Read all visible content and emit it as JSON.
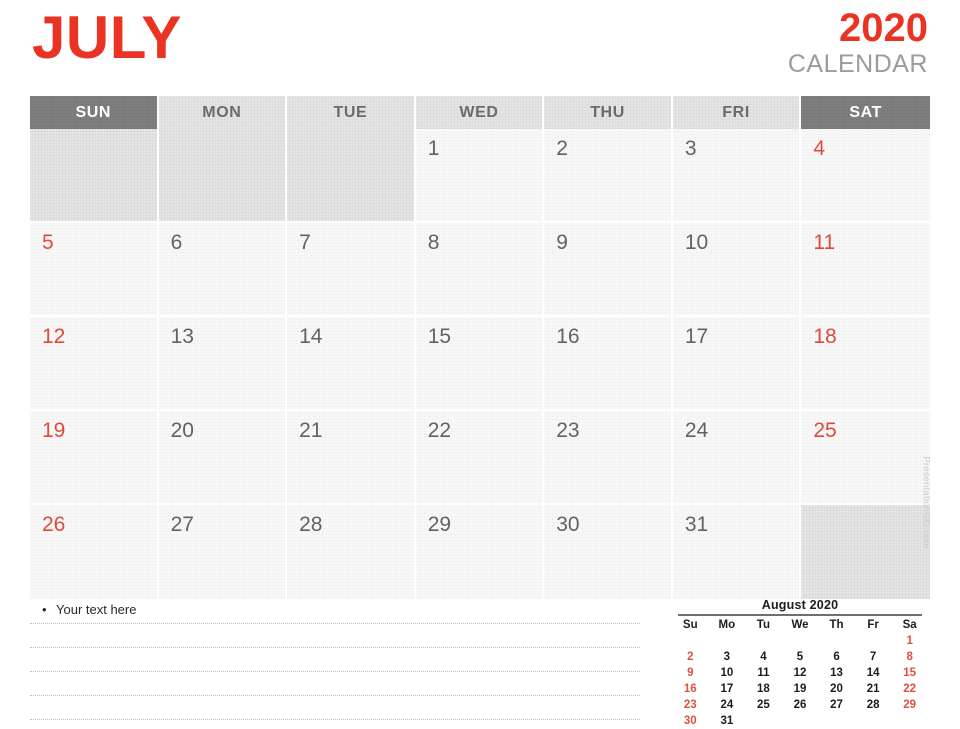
{
  "header": {
    "month": "JULY",
    "year": "2020",
    "calendar_word": "CALENDAR",
    "month_color": "#ea3323",
    "year_color": "#ea3323",
    "calendar_word_color": "#9b9b9b"
  },
  "weekdays": [
    {
      "label": "SUN",
      "weekend": true
    },
    {
      "label": "MON",
      "weekend": false
    },
    {
      "label": "TUE",
      "weekend": false
    },
    {
      "label": "WED",
      "weekend": false
    },
    {
      "label": "THU",
      "weekend": false
    },
    {
      "label": "FRI",
      "weekend": false
    },
    {
      "label": "SAT",
      "weekend": true
    }
  ],
  "weeks": [
    [
      {
        "day": "",
        "blank": true,
        "weekend": true
      },
      {
        "day": "",
        "blank": true,
        "weekend": false
      },
      {
        "day": "",
        "blank": true,
        "weekend": false
      },
      {
        "day": "1",
        "blank": false,
        "weekend": false
      },
      {
        "day": "2",
        "blank": false,
        "weekend": false
      },
      {
        "day": "3",
        "blank": false,
        "weekend": false
      },
      {
        "day": "4",
        "blank": false,
        "weekend": true
      }
    ],
    [
      {
        "day": "5",
        "blank": false,
        "weekend": true
      },
      {
        "day": "6",
        "blank": false,
        "weekend": false
      },
      {
        "day": "7",
        "blank": false,
        "weekend": false
      },
      {
        "day": "8",
        "blank": false,
        "weekend": false
      },
      {
        "day": "9",
        "blank": false,
        "weekend": false
      },
      {
        "day": "10",
        "blank": false,
        "weekend": false
      },
      {
        "day": "11",
        "blank": false,
        "weekend": true
      }
    ],
    [
      {
        "day": "12",
        "blank": false,
        "weekend": true
      },
      {
        "day": "13",
        "blank": false,
        "weekend": false
      },
      {
        "day": "14",
        "blank": false,
        "weekend": false
      },
      {
        "day": "15",
        "blank": false,
        "weekend": false
      },
      {
        "day": "16",
        "blank": false,
        "weekend": false
      },
      {
        "day": "17",
        "blank": false,
        "weekend": false
      },
      {
        "day": "18",
        "blank": false,
        "weekend": true
      }
    ],
    [
      {
        "day": "19",
        "blank": false,
        "weekend": true
      },
      {
        "day": "20",
        "blank": false,
        "weekend": false
      },
      {
        "day": "21",
        "blank": false,
        "weekend": false
      },
      {
        "day": "22",
        "blank": false,
        "weekend": false
      },
      {
        "day": "23",
        "blank": false,
        "weekend": false
      },
      {
        "day": "24",
        "blank": false,
        "weekend": false
      },
      {
        "day": "25",
        "blank": false,
        "weekend": true
      }
    ],
    [
      {
        "day": "26",
        "blank": false,
        "weekend": true
      },
      {
        "day": "27",
        "blank": false,
        "weekend": false
      },
      {
        "day": "28",
        "blank": false,
        "weekend": false
      },
      {
        "day": "29",
        "blank": false,
        "weekend": false
      },
      {
        "day": "30",
        "blank": false,
        "weekend": false
      },
      {
        "day": "31",
        "blank": false,
        "weekend": false
      },
      {
        "day": "",
        "blank": true,
        "weekend": true
      }
    ]
  ],
  "notes": {
    "bullet": "•",
    "first_line": "Your text here",
    "line_count": 5
  },
  "mini_calendar": {
    "title": "August 2020",
    "weekday_headers": [
      "Su",
      "Mo",
      "Tu",
      "We",
      "Th",
      "Fr",
      "Sa"
    ],
    "rows": [
      [
        "",
        "",
        "",
        "",
        "",
        "",
        "1"
      ],
      [
        "2",
        "3",
        "4",
        "5",
        "6",
        "7",
        "8"
      ],
      [
        "9",
        "10",
        "11",
        "12",
        "13",
        "14",
        "15"
      ],
      [
        "16",
        "17",
        "18",
        "19",
        "20",
        "21",
        "22"
      ],
      [
        "23",
        "24",
        "25",
        "26",
        "27",
        "28",
        "29"
      ],
      [
        "30",
        "31",
        "",
        "",
        "",
        "",
        ""
      ]
    ],
    "weekend_color": "#d9533f"
  },
  "watermark": {
    "text": "PresentationGO.com"
  }
}
